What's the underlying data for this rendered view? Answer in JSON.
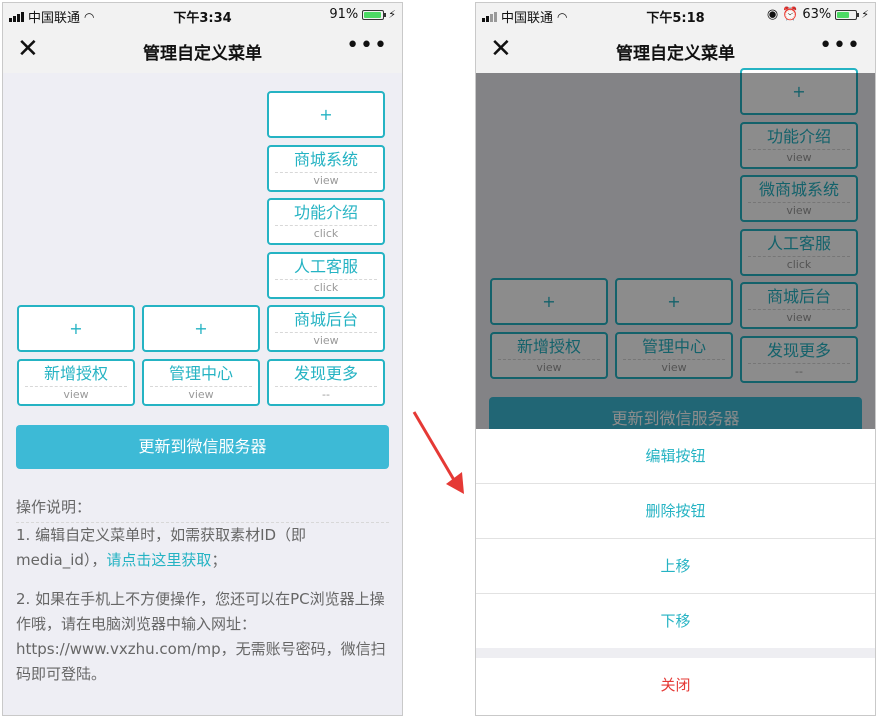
{
  "left_screen": {
    "status": {
      "carrier": "中国联通",
      "time": "下午3:34",
      "battery": "91%",
      "battery_level": 0.91
    },
    "nav": {
      "close_icon": "close-icon",
      "title": "管理自定义菜单",
      "more_icon": "ellipsis-icon"
    },
    "menu_col3": [
      {
        "name": "+",
        "type": ""
      },
      {
        "name": "商城系统",
        "type": "view"
      },
      {
        "name": "功能介绍",
        "type": "click"
      },
      {
        "name": "人工客服",
        "type": "click"
      },
      {
        "name": "商城后台",
        "type": "view"
      },
      {
        "name": "发现更多",
        "type": "--"
      }
    ],
    "menu_col1": [
      {
        "name": "+",
        "type": ""
      },
      {
        "name": "新增授权",
        "type": "view"
      }
    ],
    "menu_col2": [
      {
        "name": "+",
        "type": ""
      },
      {
        "name": "管理中心",
        "type": "view"
      }
    ],
    "update_button": "更新到微信服务器",
    "instructions": {
      "heading": "操作说明：",
      "item1_text": "1. 编辑自定义菜单时，如需获取素材ID（即media_id），",
      "item1_link": "请点击这里获取",
      "item1_end": "；",
      "item2": "2. 如果在手机上不方便操作，您还可以在PC浏览器上操作哦，请在电脑浏览器中输入网址：https://www.vxzhu.com/mp，无需账号密码，微信扫码即可登陆。"
    }
  },
  "right_screen": {
    "status": {
      "carrier": "中国联通",
      "time": "下午5:18",
      "battery": "63%",
      "battery_level": 0.63
    },
    "nav": {
      "close_icon": "close-icon",
      "title": "管理自定义菜单",
      "more_icon": "ellipsis-icon"
    },
    "menu_col3": [
      {
        "name": "+",
        "type": ""
      },
      {
        "name": "功能介绍",
        "type": "view"
      },
      {
        "name": "微商城系统",
        "type": "view"
      },
      {
        "name": "人工客服",
        "type": "click"
      },
      {
        "name": "商城后台",
        "type": "view"
      },
      {
        "name": "发现更多",
        "type": "--"
      }
    ],
    "menu_col1": [
      {
        "name": "+",
        "type": ""
      },
      {
        "name": "新增授权",
        "type": "view"
      }
    ],
    "menu_col2": [
      {
        "name": "+",
        "type": ""
      },
      {
        "name": "管理中心",
        "type": "view"
      }
    ],
    "update_button": "更新到微信服务器",
    "action_sheet": {
      "items": [
        "编辑按钮",
        "删除按钮",
        "上移",
        "下移"
      ],
      "close": "关闭"
    }
  },
  "colors": {
    "accent": "#25b3c3",
    "button": "#3dbad6",
    "danger": "#e53935",
    "arrow": "#e53935"
  }
}
